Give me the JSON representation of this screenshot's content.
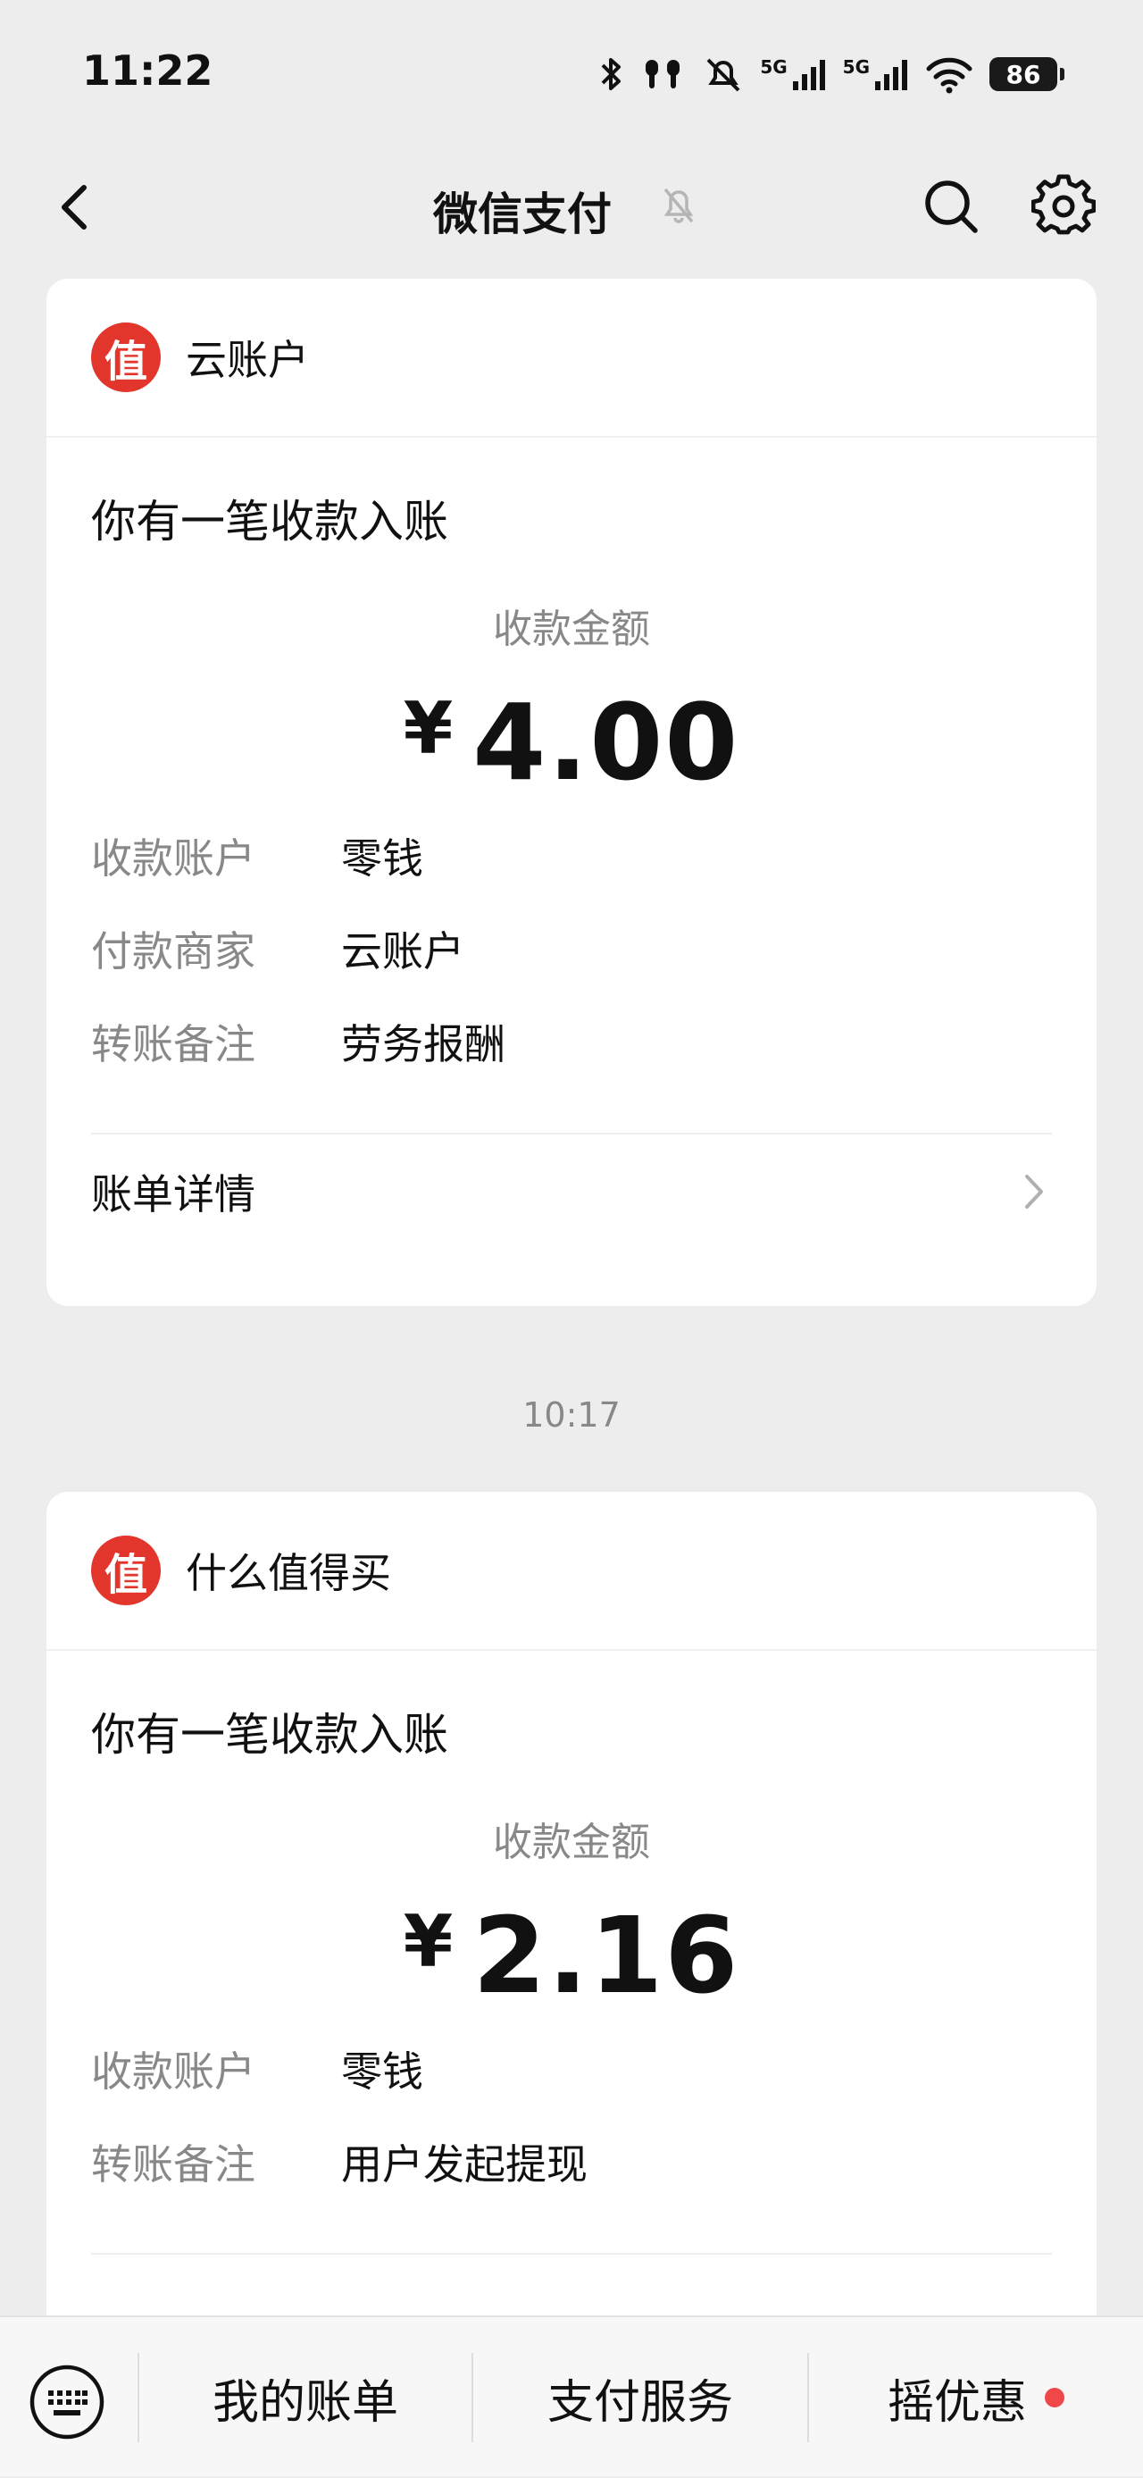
{
  "status_bar": {
    "time": "11:22",
    "network_1": "5G",
    "network_2": "5G",
    "battery": "86"
  },
  "nav": {
    "title": "微信支付",
    "icons": [
      "back-icon",
      "bell-muted-icon",
      "search-icon",
      "gear-icon"
    ]
  },
  "cards": [
    {
      "merchant": "云账户",
      "logo_char": "值",
      "title": "你有一笔收款入账",
      "amount_label": "收款金额",
      "currency": "¥",
      "amount": "4.00",
      "details": [
        {
          "key": "收款账户",
          "value": "零钱"
        },
        {
          "key": "付款商家",
          "value": "云账户"
        },
        {
          "key": "转账备注",
          "value": "劳务报酬"
        }
      ],
      "bill_detail": "账单详情"
    },
    {
      "merchant": "什么值得买",
      "logo_char": "值",
      "title": "你有一笔收款入账",
      "amount_label": "收款金额",
      "currency": "¥",
      "amount": "2.16",
      "details": [
        {
          "key": "收款账户",
          "value": "零钱"
        },
        {
          "key": "转账备注",
          "value": "用户发起提现"
        }
      ]
    }
  ],
  "time_separator": "10:17",
  "bottom_bar": {
    "tabs": [
      "我的账单",
      "支付服务",
      "摇优惠"
    ]
  },
  "colors": {
    "background": "#ededed",
    "card": "#ffffff",
    "logo_red": "#e2352c",
    "notify_dot": "#f04848",
    "muted_text": "#888888"
  }
}
